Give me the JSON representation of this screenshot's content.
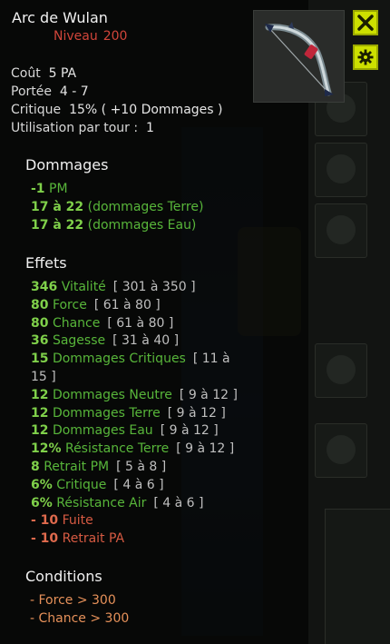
{
  "item": {
    "name": "Arc de Wulan",
    "level_label": "Niveau",
    "level_value": "200"
  },
  "stats": {
    "cout_label": "Coût",
    "cout_value": "5 PA",
    "portee_label": "Portée",
    "portee_value": "4 - 7",
    "critique_label": "Critique",
    "critique_value": "15% ( +10 Dommages )",
    "utilisation_label": "Utilisation par tour :",
    "utilisation_value": "1"
  },
  "dommages": {
    "title": "Dommages",
    "lines": [
      {
        "value": "-1",
        "text": "PM"
      },
      {
        "value": "17 à 22",
        "text": "(dommages Terre)"
      },
      {
        "value": "17 à 22",
        "text": "(dommages Eau)"
      }
    ]
  },
  "effets": {
    "title": "Effets",
    "lines": [
      {
        "value": "346",
        "text": "Vitalité",
        "range": "[ 301 à 350 ]",
        "color": "green"
      },
      {
        "value": "80",
        "text": "Force",
        "range": "[ 61 à 80 ]",
        "color": "green"
      },
      {
        "value": "80",
        "text": "Chance",
        "range": "[ 61 à 80 ]",
        "color": "green"
      },
      {
        "value": "36",
        "text": "Sagesse",
        "range": "[ 31 à 40 ]",
        "color": "green"
      },
      {
        "value": "15",
        "text": "Dommages Critiques",
        "range": "[ 11 à 15 ]",
        "color": "green"
      },
      {
        "value": "12",
        "text": "Dommages Neutre",
        "range": "[ 9 à 12 ]",
        "color": "green"
      },
      {
        "value": "12",
        "text": "Dommages Terre",
        "range": "[ 9 à 12 ]",
        "color": "green"
      },
      {
        "value": "12",
        "text": "Dommages Eau",
        "range": "[ 9 à 12 ]",
        "color": "green"
      },
      {
        "value": "12%",
        "text": "Résistance Terre",
        "range": "[ 9 à 12 ]",
        "color": "green"
      },
      {
        "value": "8",
        "text": "Retrait PM",
        "range": "[ 5 à 8 ]",
        "color": "green"
      },
      {
        "value": "6%",
        "text": "Critique",
        "range": "[ 4 à 6 ]",
        "color": "green"
      },
      {
        "value": "6%",
        "text": "Résistance Air",
        "range": "[ 4 à 6 ]",
        "color": "green"
      },
      {
        "value": "- 10",
        "text": "Fuite",
        "range": "",
        "color": "red"
      },
      {
        "value": "- 10",
        "text": "Retrait PA",
        "range": "",
        "color": "red"
      }
    ]
  },
  "conditions": {
    "title": "Conditions",
    "lines": [
      "- Force > 300",
      "- Chance > 300"
    ]
  },
  "colors": {
    "green_value": "#7fd04a",
    "green_text": "#58b63a",
    "red": "#d65a42",
    "condition": "#e6915a",
    "button_yellow": "#cde000"
  },
  "icons": {
    "close": "close-icon",
    "settings": "gear-icon",
    "item": "bow-icon"
  }
}
